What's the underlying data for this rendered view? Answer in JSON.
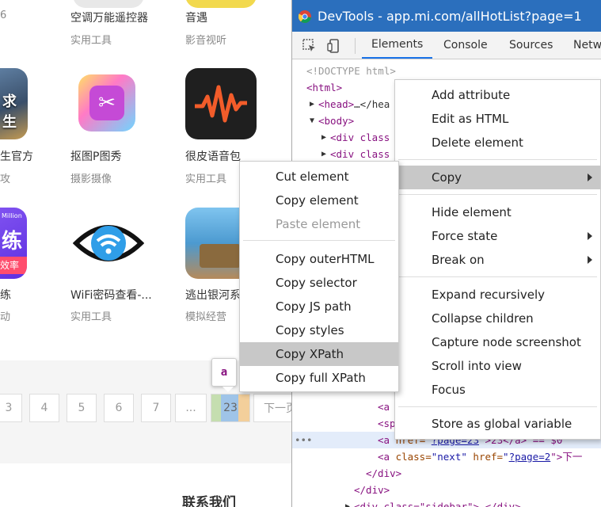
{
  "page": {
    "apps": [
      {
        "name": "空调万能遥控器",
        "category": "实用工具"
      },
      {
        "name": "音遇",
        "category": "影音视听"
      },
      {
        "name": "抠图P图秀",
        "category": "摄影摄像"
      },
      {
        "name": "很皮语音包",
        "category": "实用工具"
      },
      {
        "name": "WiFi密码查看-...",
        "category": "实用工具"
      },
      {
        "name": "逃出银河系",
        "category": "模拟经营"
      }
    ],
    "partial_left": {
      "row1_cat": "6",
      "row2_name": "生官方",
      "row2_cat": "攻",
      "row3_name": "练",
      "row3_cat": "动",
      "icon1_text": "求生",
      "icon2_text": "练",
      "icon2_sub": "效率",
      "icon2_top": "Million"
    },
    "pager": [
      "3",
      "4",
      "5",
      "6",
      "7",
      "...",
      "23",
      "下一页"
    ],
    "contact": "联系我们",
    "tooltip": "a"
  },
  "devtools": {
    "title": "DevTools - app.mi.com/allHotList?page=1",
    "tabs": [
      "Elements",
      "Console",
      "Sources",
      "Netw"
    ],
    "code": {
      "doctype": "<!DOCTYPE html>",
      "html": "<html>",
      "head_open": "<head>",
      "head_rest": "…</hea",
      "body": "<body>",
      "div_class": "<div class",
      "a_tag": "<a",
      "sp_tag": "<sp",
      "line_href": "href=",
      "line_page": "?page=23",
      "line_rest": ">23</a> == $0",
      "next_a": "<a ",
      "next_class_attr": "class=",
      "next_class_val": "\"next\"",
      "next_href_attr": " href=",
      "next_href_q": "\"",
      "next_href_val": "?page=2",
      "next_rest": "\">下一",
      "div_close": "</div>",
      "div_close2": "</div>",
      "sidebar": "<div class=\"sidebar\">…</div>",
      "dots": "•••"
    }
  },
  "menu_main": {
    "items": [
      "Add attribute",
      "Edit as HTML",
      "Delete element",
      "Copy",
      "Hide element",
      "Force state",
      "Break on",
      "Expand recursively",
      "Collapse children",
      "Capture node screenshot",
      "Scroll into view",
      "Focus",
      "Store as global variable"
    ]
  },
  "menu_copy": {
    "items": [
      "Cut element",
      "Copy element",
      "Paste element",
      "Copy outerHTML",
      "Copy selector",
      "Copy JS path",
      "Copy styles",
      "Copy XPath",
      "Copy full XPath"
    ]
  },
  "colors": {
    "title_bar": "#2b6fbd",
    "menu_highlight": "#c8c8c8",
    "tag": "#881280",
    "attr": "#994500",
    "value": "#1a1aa6"
  }
}
